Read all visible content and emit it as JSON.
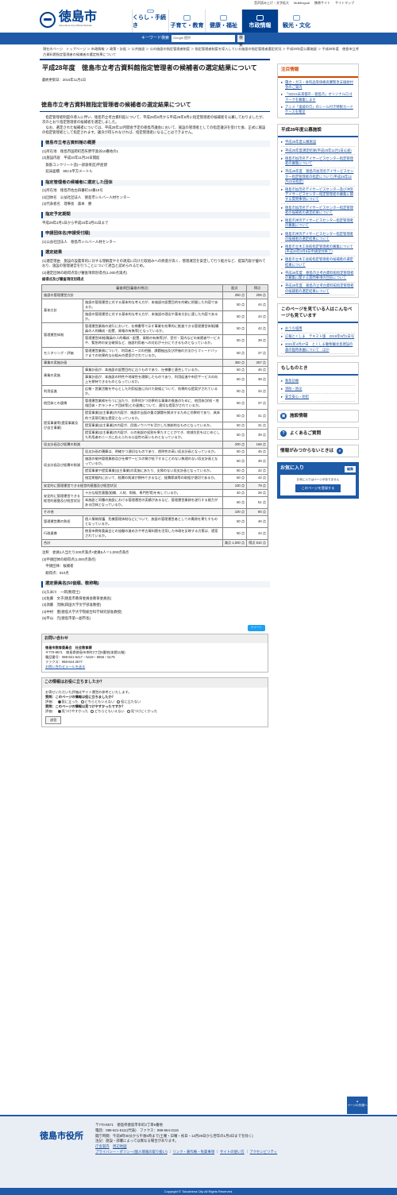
{
  "top_links": [
    "音声読み上げ・文字拡大",
    "Multilingual",
    "携帯サイト",
    "サイトマップ"
  ],
  "site": {
    "name": "徳島市",
    "sub": "Tokushima City Official Website"
  },
  "gnav": [
    "くらし・手続き",
    "子育て・教育",
    "健康・福祉",
    "市政情報",
    "観光・文化"
  ],
  "search": {
    "label": "キーワード検索",
    "placeholder": "Google 提供",
    "button": "検索"
  },
  "breadcrumb": "現在のページ　トップページ ＞ 市政情報 ＞ 政策・計画 ＞ 公共施設 ＞ 公の施設の指定管理者制度 ＞ 指定管理者制度を導入している施設の指定管理者選定状況 ＞ 平成28年度公募施設 ＞ 平成28年度　徳島市立考古資料館指定管理者の候補者の選定結果について",
  "title": "平成28年度　徳島市立考古資料館指定管理者の候補者の選定結果について",
  "updated": "最終更新日：2016年11月1日",
  "h2": "徳島市立考古資料館指定管理者の候補者の選定結果について",
  "intro": "　指定管理者制度の導入に伴い、徳島市立考古資料館について、平成28年8月から平成28年9月に指定管理者の候補者を公募しておりましたが、次のとおり指定管理者の候補者を選定しました。\n　なお、選定された候補者については、平成28年12月開会予定の徳島市議会において、施設の管理者としての指定議決を受けた後、正式に施設の指定管理者として指定されます。議決が得られなければ、指定管理者になることはできません。",
  "sec1": {
    "h": "徳島市立考古資料館の概要",
    "lines": [
      "(1)所在地　徳島市国府町西矢野字奥谷10番地の1",
      "(2)施設内容　平成10年11月24日開館",
      "　鉄筋コンクリート造(一部鉄骨造)平屋建",
      "　延床面積　802.5平方メートル"
    ]
  },
  "sec2": {
    "h": "指定管理者の候補者に選定した団体",
    "lines": [
      "(1)所在地　徳島市佐古四番町12番10号",
      "(2)団体名　公益社団法人　徳島市シルバー人材センター",
      "(3)代表者名　理事長　森本　勝"
    ]
  },
  "sec3": {
    "h": "指定予定期間",
    "lines": [
      "平成29年4月1日から平成34年3月31日まで"
    ]
  },
  "sec4": {
    "h": "申請団体名(申請受付順)",
    "lines": [
      "(1)公益社団法人　徳島市シルバー人材センター"
    ]
  },
  "sec5": {
    "h": "選定結果",
    "lines": [
      "(1)選定理由　施設の設置目的に対する理解度やその達成に向けた取組みへの熱意が高く、管理運営を安定して行う能力など、提案内容が優れており、施設の管理運営を行うことについて適当と認められるため。",
      "(2)選定団体の総得点及び審査項目別得点(1,000点満点)"
    ],
    "sub": "総得点及び審査項目別得点"
  },
  "table": {
    "head": [
      "審査項目(審査の視点)",
      "配点",
      "得点"
    ],
    "rows": [
      [
        "施設の管理運営方針",
        "",
        "250 点",
        "206 点"
      ],
      [
        "基本方針",
        "施設の管理運営に対する基本的な考え方が、本施設の設置目的を的確に把握した内容であるか。",
        "50 点",
        "44 点"
      ],
      [
        "",
        "施設の管理運営に対する基本的な考え方が、本施設の理念や基本方針に適した内容であるか。",
        "50 点",
        "44 点"
      ],
      [
        "管理運営体制",
        "管理運営業務の遂行において、仕様書等で示す事業を効果的に推進できる管理運営体制(職員の人的構成・配置、資格の有無等)となっているか。",
        "50 点",
        "42 点"
      ],
      [
        "",
        "管理運営体制(職員の人的構成・配置、資格の有無等)が、受付・案内などの来館者サービスや、緊急時の安全確保など、施設利用者への対応が十分にできるものとなっているか。",
        "50 点",
        "39 点"
      ],
      [
        "モニタリング・評価",
        "管理運営業務について、利用者ニーズの把握、課題抽出及び評価の方法からフィードバックまでの効果的な仕組みの提案がされているか。",
        "50 点",
        "37 点"
      ],
      [
        "事業の実施計画",
        "",
        "350 点",
        "267 点"
      ],
      [
        "事業の実施",
        "事業計画が、本施設の設置目的に沿うものであり、仕様書と適合しているか。",
        "50 点",
        "46 点"
      ],
      [
        "",
        "事業計画が、本施設の特性や地域性を理解したものであり、利用促進や市民サービスの向上を期待できるものとなっているか。",
        "50 点",
        "39 点"
      ],
      [
        "利用促進",
        "広報・営業活動を中心とした利用促進に向けた取組について、効果的な提案がされているか。",
        "50 点",
        "34 点"
      ],
      [
        "他団体との連携",
        "管理運営業務を行うに当たり、効率的かつ効果的な事業の推進のために、他団体(学校・地域団体・ボランティア団体等)との連携について、適切な提案がされているか。",
        "50 点",
        "37 点"
      ],
      [
        "提案事業等(提案事業及び自主事業)",
        "提案事業(自主事業)の内容が、施設の当面の重点課題を解決するために効果的であり、具体的で実現可能な提案となっているか。",
        "50 点",
        "41 点"
      ],
      [
        "",
        "提案事業(自主事業)の内容が、民間ノウハウを活かした独創的なものとなっているか。",
        "50 点",
        "31 点"
      ],
      [
        "",
        "提案事業(自主事業)の内容が、公の施設の役割を果たすことができ、地域住民をはじめとした利用者のニーズに応えられる公益性の高いものとなっているか。",
        "50 点",
        "39 点"
      ],
      [
        "収支計画及び経費の削減",
        "",
        "200 点",
        "168 点"
      ],
      [
        "収支計画及び経費の削減",
        "収支計画の積算は、明確かつ適切なものであり、透明性の高い収支計画となっているか。",
        "50 点",
        "45 点"
      ],
      [
        "",
        "施設の維持管理業務及び仕様サービスの質が低下することのない無理のない収支計画となっているか。",
        "50 点",
        "39 点"
      ],
      [
        "",
        "提案事業や提案事業(自主事業)の実施にあたり、支障のない収支計画となっているか。",
        "50 点",
        "42 点"
      ],
      [
        "",
        "指定期間内において、経費の削減が期待できるなど、経費節減等の取組が適切であるか。",
        "50 点",
        "42 点"
      ],
      [
        "安定的に管理運営できる経営的基盤及び経営状況",
        "",
        "100 点",
        "79 点"
      ],
      [
        "安定的に管理運営できる経営的基盤及び経営状況",
        "十分な経営基盤(組織、人材、財務、専門性等)を有しているか。",
        "40 点",
        "28 点"
      ],
      [
        "",
        "本施設と同種の施設における管理運営の実績があるなど、管理運営業務を遂行する能力がある団体となっているか。",
        "60 点",
        "51 点"
      ],
      [
        "その他",
        "",
        "100 点",
        "90 点"
      ],
      [
        "管理運営費の負担",
        "個人情報保護、危機管理体制などについて、施設の管理運営者としての責務を果たすものとなっているか。",
        "50 点",
        "46 点"
      ],
      [
        "行政連携",
        "徳島市教育委員会との協働の進め方や考古資料館を活用した市政を反映する方策は、提案されているか。",
        "50 点",
        "44 点"
      ],
      [
        "合計",
        "",
        "満点 1,000 点",
        "得点 810 点"
      ]
    ]
  },
  "notes": [
    "注釈　委員1人当たり200点満点×委員5人＝1,000点満点",
    "(3)申請団体の総得点(1,000点満点)",
    "　申請団体：候補者",
    "　総得点：810点"
  ],
  "sec6": {
    "h": "選定委員名(50音順、敬称略)",
    "lines": [
      "(1)久米川　一郎(税理士)",
      "(2)佐藤　文子(徳島市教育委員会教育委員長)",
      "(3)須藤　茂樹(四国大学文学部准教授)",
      "(4)中村　豊(徳島大学大学院総合科学研究部准教授)",
      "(5)平山　元(徳島市第一副市長)"
    ]
  },
  "tweet": "ツイート",
  "inquiry": {
    "h": "お問い合わせ",
    "org": "徳島市教育委員会　社会教育課",
    "lines": [
      "〒770-8571　徳島県徳島市幸町2丁目5番地(本館11階)",
      "電話番号：088-621-5417・5419・5566・5179",
      "ファクス：088-624-2577"
    ],
    "mail": "お問い合わせメールを送る"
  },
  "feedback": {
    "h": "この情報はお役に立ちましたか？",
    "lead": "お寄せいただいた評価はサイト運営の参考といたします。",
    "q1": "質問：このページの情報は役に立ちましたか？",
    "q1opts": [
      "役に立った",
      "どちらともいえない",
      "役に立たない"
    ],
    "q2": "質問：このページの情報は見つけやすかったですか？",
    "q2opts": [
      "見つけやすかった",
      "どちらともいえない",
      "見つけにくかった"
    ],
    "eval": "評価：",
    "send": "送信"
  },
  "side": {
    "notice_h": "注目情報",
    "notice": [
      "電力・ガス・食料品等価格高騰緊急支援給付金のご案内",
      "「SDGs未来都市・徳島市」オリジナルロゴマークを募集します",
      "アニメ「鬼滅の刃」のシール付き特製カードケースを贈呈"
    ],
    "list_h": "平成28年度公募施設",
    "list": [
      "平成28年度公募施設",
      "平成28年度選定結果(平成28年11月1日公表)",
      "徳島市加茂名デイサービスセンター指定管理者の募集について",
      "平成28年度　徳島市加茂名デイサービスセンター指定管理者の指定について(平成28年12月20日指定)",
      "徳島市加茂名デイサービスセンター及び沖浜デイサービスセンター指定管理者の募集に関する質問事項について",
      "徳島市加茂名デイサービスセンター指定管理者の候補者の選定結果について",
      "徳島市沖浜デイサービスセンター指定管理者の募集について",
      "徳島市沖浜デイサービスセンター指定管理者の候補者の選定結果について",
      "徳島市立木工会館指定管理者の募集について(平成28年9月8日申請受付終了)",
      "徳島市立木工会館指定管理者の候補者の選定結果について",
      "平成28年度　徳島市立考古資料館指定管理者の募集に関する質問事項の回答について",
      "平成28年度　徳島市立考古資料館指定管理者の候補者の選定結果について"
    ],
    "others_h": "このページを見ている人はこんなページも見ています",
    "others": [
      "おうち城博",
      "広報とくしま　テキスト版　2019年5月1日号",
      "2021年4月27日　とくしま動物園北島建設の森の臨時休園について　ほか"
    ],
    "emerg_h": "もしものとき",
    "emerg": [
      "救急診療",
      "消防・防災",
      "安全安心・防犯"
    ],
    "btns": [
      "施設情報",
      "よくあるご質問",
      "情報がみつからないときは"
    ],
    "fav": {
      "title": "お気に入り",
      "edit": "編集",
      "empty": "お気に入りはページがありません",
      "reg": "このページを登録する"
    }
  },
  "pagetop": "ページの先頭へ",
  "footer": {
    "name": "徳島市役所",
    "lines": [
      "〒770-8571　徳島県徳島市幸町2丁目5番地",
      "電話：088-621-5111(代表)　ファクス：088-654-2116",
      "開庁時間：午前8時30分から午後5時まで(土曜・日曜・祝日・12月29日から翌年の1月3日までを除く)",
      "注記：施設・部署によっては異なる場合があります。"
    ],
    "links1": [
      "庁舎案内",
      "周辺地図"
    ],
    "links2": [
      "プライバシー・ポリシー(個人情報の取り扱い)",
      "リンク・著作権・免責事項",
      "サイトの使い方",
      "アクセシビリティ"
    ],
    "copy": "Copyright © Tokushima City All Rights Reserved."
  }
}
